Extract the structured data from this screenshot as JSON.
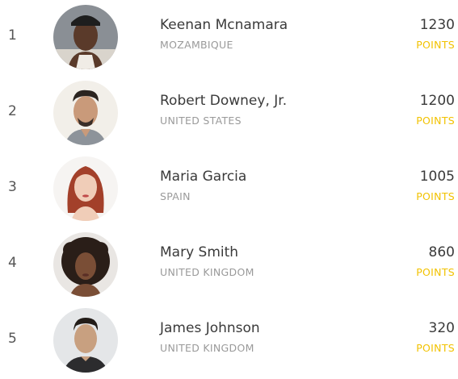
{
  "theme": {
    "points_color": "#f2c200"
  },
  "players": [
    {
      "rank": "1",
      "name": "Keenan Mcnamara",
      "country": "MOZAMBIQUE",
      "points": "1230",
      "points_label": "POINTS",
      "avatar": "avatar-icon"
    },
    {
      "rank": "2",
      "name": "Robert Downey, Jr.",
      "country": "UNITED STATES",
      "points": "1200",
      "points_label": "POINTS",
      "avatar": "avatar-icon"
    },
    {
      "rank": "3",
      "name": "Maria Garcia",
      "country": "SPAIN",
      "points": "1005",
      "points_label": "POINTS",
      "avatar": "avatar-icon"
    },
    {
      "rank": "4",
      "name": "Mary Smith",
      "country": "UNITED KINGDOM",
      "points": "860",
      "points_label": "POINTS",
      "avatar": "avatar-icon"
    },
    {
      "rank": "5",
      "name": "James Johnson",
      "country": "UNITED KINGDOM",
      "points": "320",
      "points_label": "POINTS",
      "avatar": "avatar-icon"
    }
  ]
}
